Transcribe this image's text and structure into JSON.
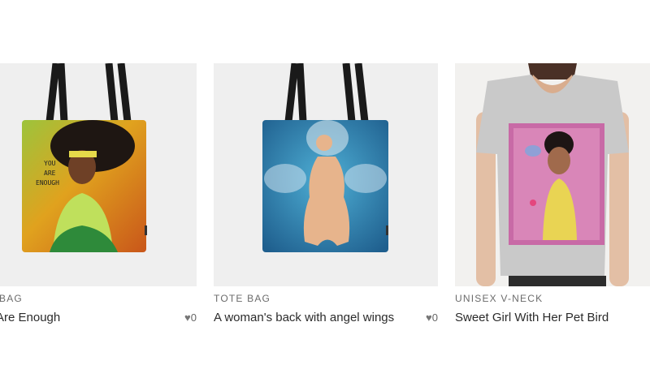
{
  "products": [
    {
      "category": "BAG",
      "title": "Are Enough",
      "likes": "0",
      "artwork_text": [
        "YOU",
        "ARE",
        "ENOUGH"
      ]
    },
    {
      "category": "TOTE BAG",
      "title": "A woman's back with angel wings",
      "likes": "0"
    },
    {
      "category": "UNISEX V-NECK",
      "title": "Sweet Girl With Her Pet Bird"
    }
  ],
  "icons": {
    "like": "heart-icon"
  },
  "colors": {
    "text": "#2b2b2b",
    "category": "#6b6b6b",
    "image_bg": "#efefef"
  }
}
